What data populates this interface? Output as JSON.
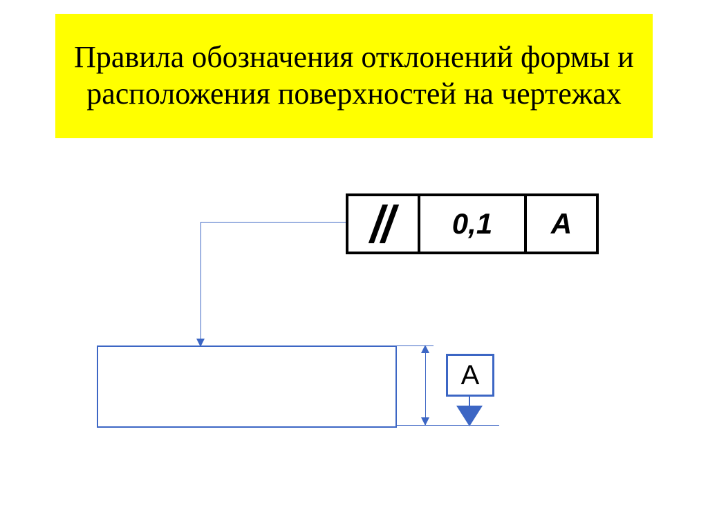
{
  "title": "Правила обозначения отклонений формы и расположения поверхностей на чертежах",
  "tolerance_frame": {
    "symbol": "parallelism",
    "value": "0,1",
    "datum_ref": "А"
  },
  "datum": {
    "label": "А"
  },
  "colors": {
    "highlight": "#ffff00",
    "stroke": "#3c66c4",
    "black": "#000000"
  }
}
